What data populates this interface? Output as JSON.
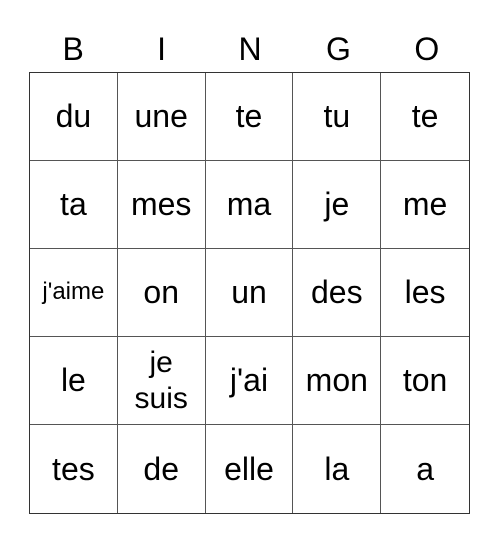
{
  "header": [
    "B",
    "I",
    "N",
    "G",
    "O"
  ],
  "grid": [
    [
      "du",
      "une",
      "te",
      "tu",
      "te"
    ],
    [
      "ta",
      "mes",
      "ma",
      "je",
      "me"
    ],
    [
      "j'aime",
      "on",
      "un",
      "des",
      "les"
    ],
    [
      "le",
      "je suis",
      "j'ai",
      "mon",
      "ton"
    ],
    [
      "tes",
      "de",
      "elle",
      "la",
      "a"
    ]
  ]
}
